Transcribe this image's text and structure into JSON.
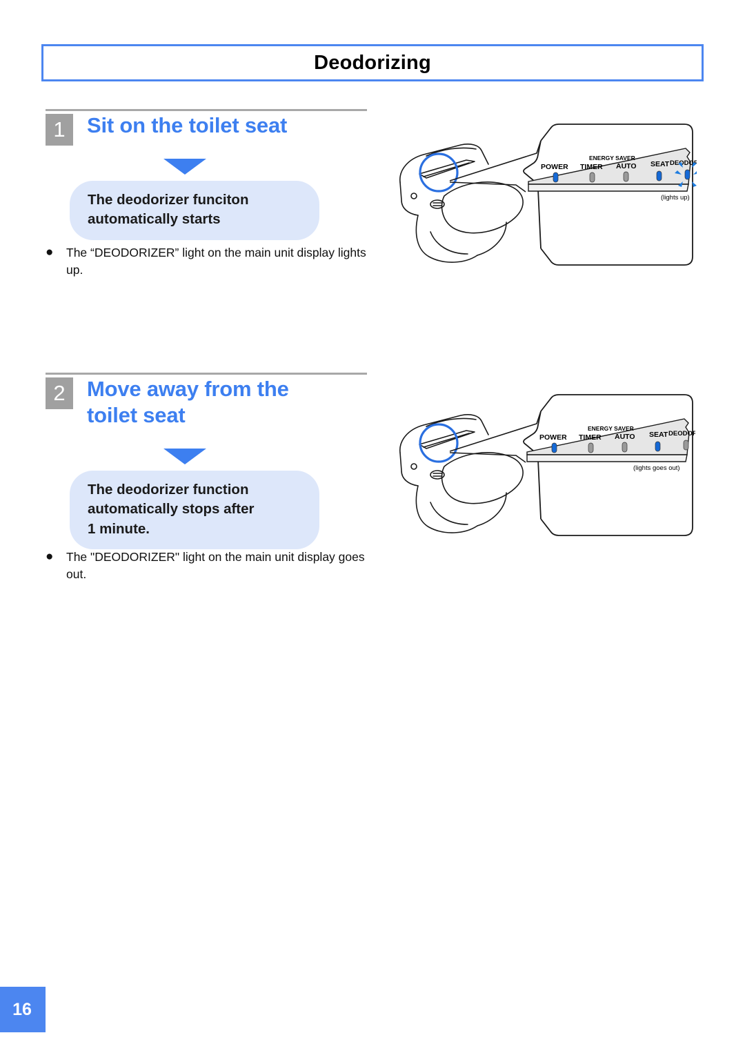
{
  "page": {
    "title": "Deodorizing",
    "page_number": "16",
    "accent_blue": "#4C86F0",
    "heading_blue": "#3D7FF0",
    "pill_blue": "#DDE7FA",
    "step_badge_gray": "#A0A0A0"
  },
  "steps": [
    {
      "number": "1",
      "title": "Sit on the toilet seat",
      "callout": "The deodorizer funciton\nautomatically starts",
      "bullet": "The “DEODORIZER” light on the main unit display lights up.",
      "bullet_marker": "●",
      "panel": {
        "group_label": "ENERGY SAVER",
        "caption": "(lights up)",
        "leds": [
          {
            "label": "POWER",
            "state": "on",
            "color": "#1569D6"
          },
          {
            "label": "TIMER",
            "state": "off",
            "color": "#9A9A9A"
          },
          {
            "label": "AUTO",
            "state": "off",
            "color": "#9A9A9A"
          },
          {
            "label": "SEAT",
            "state": "on",
            "color": "#1569D6"
          },
          {
            "label": "DEODORIZER",
            "state": "on-blinking",
            "color": "#1569D6"
          }
        ]
      }
    },
    {
      "number": "2",
      "title": "Move away from the\ntoilet seat",
      "callout": "The deodorizer function\nautomatically stops after\n1 minute.",
      "bullet": "The \"DEODORIZER\" light on the main unit display goes out.",
      "bullet_marker": "●",
      "panel": {
        "group_label": "ENERGY SAVER",
        "caption": "(lights goes out)",
        "leds": [
          {
            "label": "POWER",
            "state": "on",
            "color": "#1569D6"
          },
          {
            "label": "TIMER",
            "state": "off",
            "color": "#9A9A9A"
          },
          {
            "label": "AUTO",
            "state": "off",
            "color": "#9A9A9A"
          },
          {
            "label": "SEAT",
            "state": "on",
            "color": "#1569D6"
          },
          {
            "label": "DEODORIZER",
            "state": "off",
            "color": "#9A9A9A"
          }
        ]
      }
    }
  ]
}
